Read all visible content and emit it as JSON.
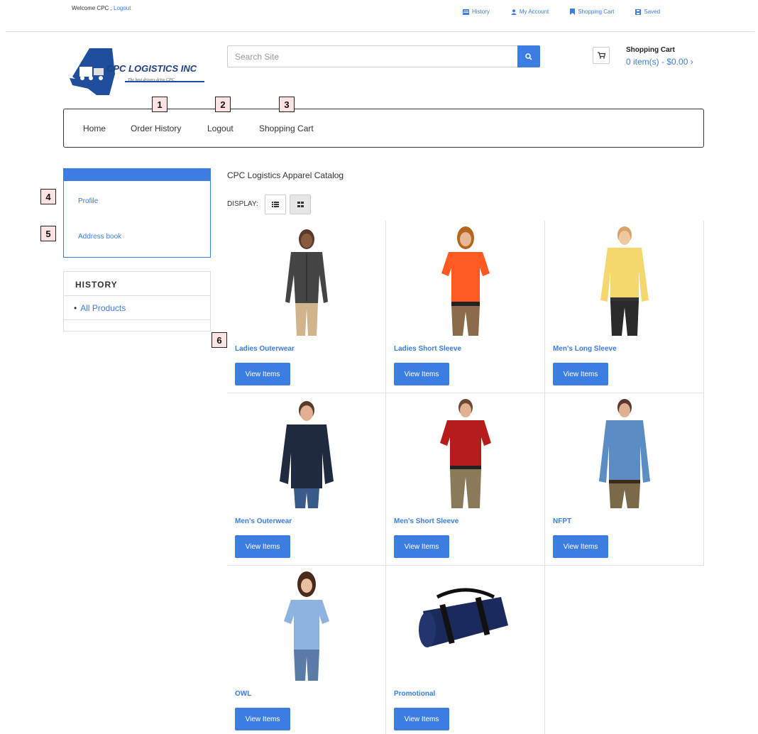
{
  "header": {
    "welcome_text": "Welcome CPC ,",
    "logout_link": "Logout",
    "links": [
      {
        "label": "History",
        "icon": "history-icon"
      },
      {
        "label": "My Account",
        "icon": "user-icon"
      },
      {
        "label": "Shopping Cart",
        "icon": "bookmark-icon"
      },
      {
        "label": "Saved",
        "icon": "save-icon"
      }
    ]
  },
  "logo": {
    "name": "CPC LOGISTICS INC",
    "tagline": "The best drivers drive CPC"
  },
  "search": {
    "placeholder": "Search Site"
  },
  "cart": {
    "title": "Shopping Cart",
    "summary": "0 item(s) - $0.00 ›"
  },
  "nav": {
    "items": [
      "Home",
      "Order History",
      "Logout",
      "Shopping Cart"
    ]
  },
  "markers": [
    "1",
    "2",
    "3",
    "4",
    "5",
    "6"
  ],
  "account": {
    "links": [
      "Profile",
      "Address book"
    ]
  },
  "history": {
    "title": "HISTORY",
    "items": [
      "All Products"
    ]
  },
  "catalog": {
    "title": "CPC Logistics Apparel Catalog",
    "display_label": "DISPLAY:",
    "button_label": "View Items",
    "products": [
      {
        "name": "Ladies Outerwear",
        "icon": "ladies-jacket"
      },
      {
        "name": "Ladies Short Sleeve",
        "icon": "ladies-polo"
      },
      {
        "name": "Men's Long Sleeve",
        "icon": "mens-shirt"
      },
      {
        "name": "Men's Outerwear",
        "icon": "mens-jacket"
      },
      {
        "name": "Men's Short Sleeve",
        "icon": "mens-polo"
      },
      {
        "name": "NFPT",
        "icon": "mens-denim-shirt"
      },
      {
        "name": "OWL",
        "icon": "ladies-blue-polo"
      },
      {
        "name": "Promotional",
        "icon": "blanket-roll"
      }
    ]
  },
  "colors": {
    "accent": "#3b7de1",
    "marker_bg": "#fde2e2"
  }
}
